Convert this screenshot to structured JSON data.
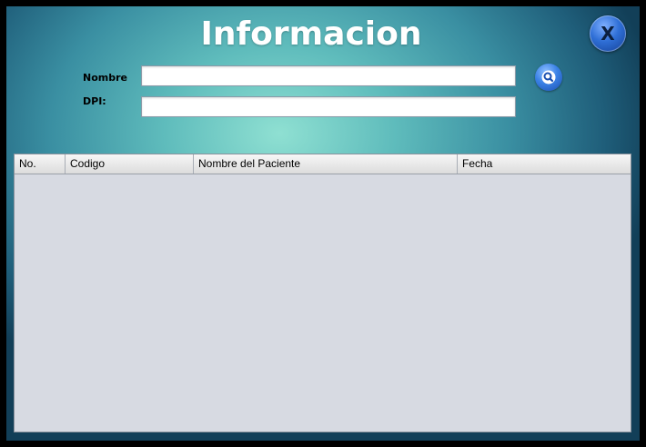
{
  "window": {
    "title": "Informacion",
    "close_label": "X"
  },
  "form": {
    "nombre_label": "Nombre",
    "nombre_value": "",
    "dpi_label": "DPI:",
    "dpi_value": ""
  },
  "search_button": {
    "icon": "search-icon"
  },
  "table": {
    "columns": [
      "No.",
      "Codigo",
      "Nombre del Paciente",
      "Fecha"
    ],
    "rows": []
  },
  "colors": {
    "background_center": "#8fe0d2",
    "background_edge": "#123f58",
    "button_blue": "#2f6fd6",
    "table_body": "#d7dae2"
  }
}
